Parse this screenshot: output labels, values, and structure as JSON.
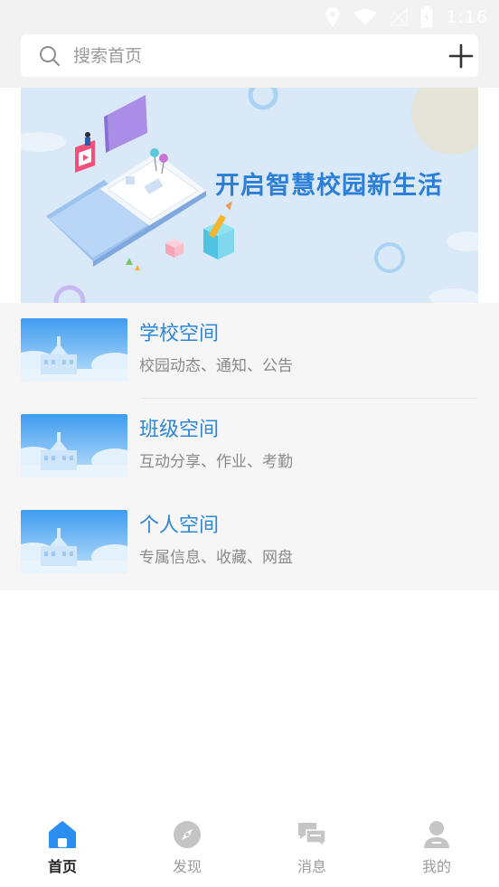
{
  "status_bar": {
    "time": "1:16",
    "icons": [
      "location-icon",
      "wifi-icon",
      "signal-icon",
      "battery-icon"
    ]
  },
  "search": {
    "placeholder": "搜索首页",
    "icon": "search-icon",
    "add_icon": "plus-icon"
  },
  "banner": {
    "title": "开启智慧校园新生活"
  },
  "spaces": [
    {
      "title": "学校空间",
      "subtitle": "校园动态、通知、公告"
    },
    {
      "title": "班级空间",
      "subtitle": "互动分享、作业、考勤"
    },
    {
      "title": "个人空间",
      "subtitle": "专属信息、收藏、网盘"
    }
  ],
  "nav": [
    {
      "label": "首页",
      "icon": "home-icon",
      "active": true
    },
    {
      "label": "发现",
      "icon": "compass-icon",
      "active": false
    },
    {
      "label": "消息",
      "icon": "chat-icon",
      "active": false
    },
    {
      "label": "我的",
      "icon": "user-icon",
      "active": false
    }
  ],
  "colors": {
    "accent": "#2e87d6",
    "banner_bg": "#d9e9f8",
    "nav_active": "#2a8ff0",
    "nav_inactive": "#c5c5c5"
  }
}
